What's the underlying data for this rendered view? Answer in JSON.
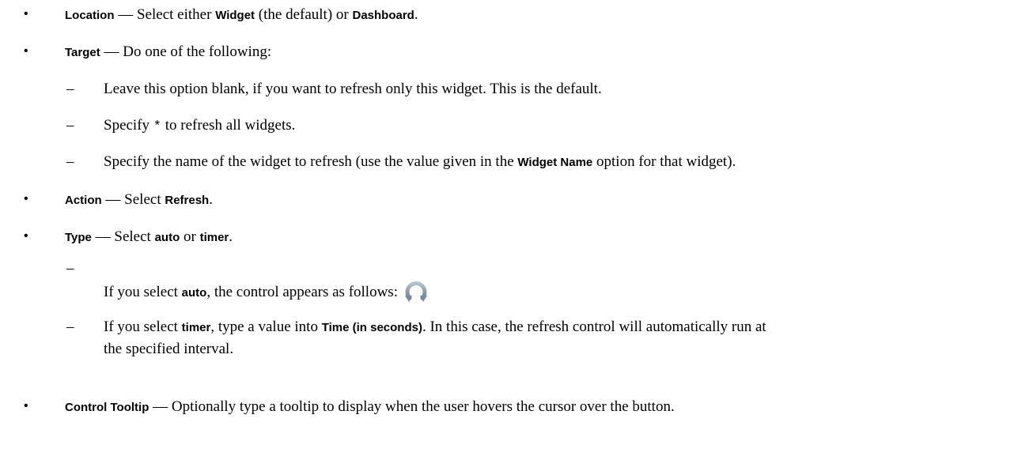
{
  "list": {
    "bullet_glyph": "•",
    "dash_glyph": "–",
    "location": {
      "term": "Location",
      "sep": " — Select either ",
      "opt1": "Widget",
      "mid": " (the default) or ",
      "opt2": "Dashboard",
      "end": "."
    },
    "target": {
      "term": "Target",
      "text": " — Do one of the following:",
      "sub1": "Leave this option blank, if you want to refresh only this widget. This is the default.",
      "sub2_pre": "Specify ",
      "sub2_code": "*",
      "sub2_post": " to refresh all widgets.",
      "sub3_pre": "Specify the name of the widget to refresh (use the value given in the ",
      "sub3_term": "Widget Name",
      "sub3_post": " option for that widget)."
    },
    "action": {
      "term": "Action",
      "sep": " — Select ",
      "opt": "Refresh",
      "end": "."
    },
    "type": {
      "term": "Type",
      "sep": " — Select ",
      "opt1": "auto",
      "mid": " or ",
      "opt2": "timer",
      "end": ".",
      "sub1_pre": "If you select ",
      "sub1_term": "auto",
      "sub1_post": ", the control appears as follows:",
      "sub2_pre": "If you select ",
      "sub2_term": "timer",
      "sub2_mid": ", type a value into ",
      "sub2_field": "Time (in seconds)",
      "sub2_post": ". In this case, the refresh control will automatically run at",
      "sub2_cont": "the specified interval."
    },
    "tooltip": {
      "term": "Control Tooltip",
      "text": " — Optionally type a tooltip to display when the user hovers the cursor over the button."
    }
  },
  "icons": {
    "refresh_icon": "refresh-icon"
  }
}
